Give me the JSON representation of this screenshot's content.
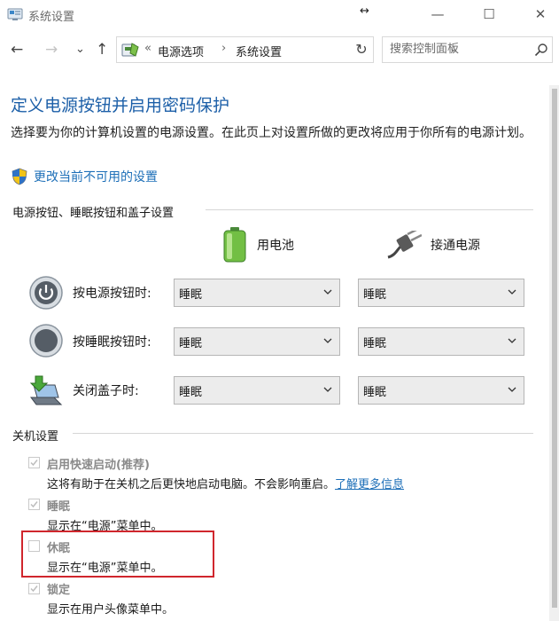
{
  "window": {
    "title": "系统设置",
    "minimize_glyph": "—",
    "maximize_glyph": "☐",
    "close_glyph": "✕",
    "resize_glyph": "↔"
  },
  "nav": {
    "back": "←",
    "forward": "→",
    "recent": "⌄",
    "up": "↑"
  },
  "address": {
    "prefix": "«",
    "crumbs": [
      "电源选项",
      "系统设置"
    ],
    "separator": "›",
    "dropdown": "⌄",
    "refresh": "↻"
  },
  "search": {
    "placeholder": "搜索控制面板"
  },
  "main": {
    "heading": "定义电源按钮并启用密码保护",
    "description": "选择要为你的计算机设置的电源设置。在此页上对设置所做的更改将应用于你所有的电源计划。",
    "change_link": "更改当前不可用的设置"
  },
  "buttons_section": {
    "title": "电源按钮、睡眠按钮和盖子设置",
    "col_battery": "用电池",
    "col_plugged": "接通电源",
    "rows": [
      {
        "label": "按电源按钮时:",
        "battery": "睡眠",
        "plugged": "睡眠"
      },
      {
        "label": "按睡眠按钮时:",
        "battery": "睡眠",
        "plugged": "睡眠"
      },
      {
        "label": "关闭盖子时:",
        "battery": "睡眠",
        "plugged": "睡眠"
      }
    ]
  },
  "shutdown_section": {
    "title": "关机设置",
    "options": [
      {
        "label": "启用快速启动(推荐)",
        "desc": "这将有助于在关机之后更快地启动电脑。不会影响重启。",
        "link": "了解更多信息",
        "checked": true
      },
      {
        "label": "睡眠",
        "desc": "显示在“电源”菜单中。",
        "checked": true
      },
      {
        "label": "休眠",
        "desc": "显示在“电源”菜单中。",
        "checked": false
      },
      {
        "label": "锁定",
        "desc": "显示在用户头像菜单中。",
        "checked": true
      }
    ]
  },
  "colors": {
    "heading": "#1c5fa8",
    "link": "#1d6fb8",
    "highlight_border": "#d0262d",
    "select_bg": "#ececec"
  }
}
